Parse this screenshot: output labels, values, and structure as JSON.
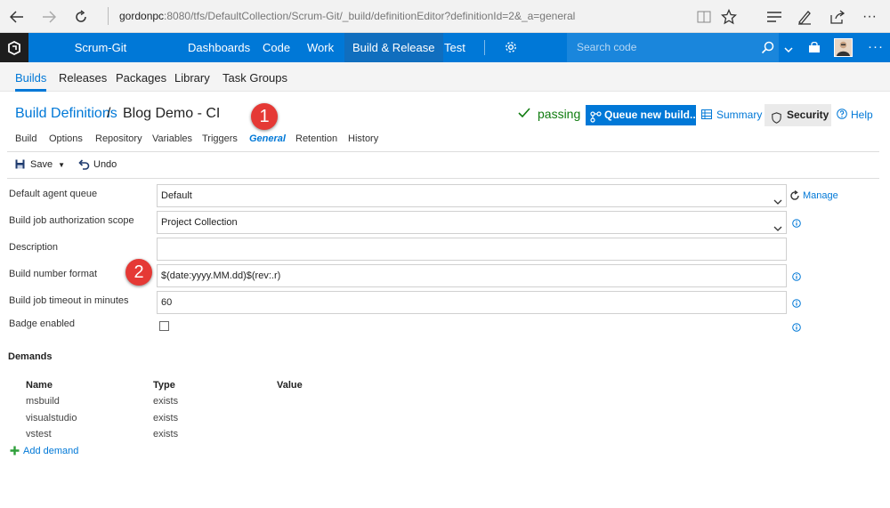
{
  "browser": {
    "url_host": "gordonpc",
    "url_rest": ":8080/tfs/DefaultCollection/Scrum-Git/_build/definitionEditor?definitionId=2&_a=general"
  },
  "topnav": {
    "project": "Scrum-Git",
    "items": [
      "Dashboards",
      "Code",
      "Work",
      "Build & Release",
      "Test"
    ],
    "active": "Build & Release",
    "search_placeholder": "Search code",
    "more": "···"
  },
  "hub": {
    "items": [
      "Builds",
      "Releases",
      "Packages",
      "Library",
      "Task Groups"
    ],
    "active": "Builds"
  },
  "header": {
    "breadcrumb": "Build Definitions",
    "separator": "/",
    "title": "Blog Demo - CI",
    "status": "passing",
    "queue_button": "Queue new build...",
    "summary": "Summary",
    "security": "Security",
    "help": "Help"
  },
  "annotations": [
    "1",
    "2"
  ],
  "tabs": {
    "items": [
      "Build",
      "Options",
      "Repository",
      "Variables",
      "Triggers",
      "General",
      "Retention",
      "History"
    ],
    "active": "General"
  },
  "toolbar": {
    "save": "Save",
    "undo": "Undo"
  },
  "form": {
    "agent_queue_label": "Default agent queue",
    "agent_queue_value": "Default",
    "manage": "Manage",
    "auth_scope_label": "Build job authorization scope",
    "auth_scope_value": "Project Collection",
    "description_label": "Description",
    "description_value": "",
    "number_format_label": "Build number format",
    "number_format_value": "$(date:yyyy.MM.dd)$(rev:.r)",
    "timeout_label": "Build job timeout in minutes",
    "timeout_value": "60",
    "badge_label": "Badge enabled",
    "badge_checked": false
  },
  "demands": {
    "heading": "Demands",
    "columns": [
      "Name",
      "Type",
      "Value"
    ],
    "rows": [
      {
        "name": "msbuild",
        "type": "exists",
        "value": ""
      },
      {
        "name": "visualstudio",
        "type": "exists",
        "value": ""
      },
      {
        "name": "vstest",
        "type": "exists",
        "value": ""
      }
    ],
    "add": "Add demand"
  },
  "colors": {
    "brand": "#0078d7",
    "status_ok": "#107c10",
    "annotation": "#e53935"
  }
}
